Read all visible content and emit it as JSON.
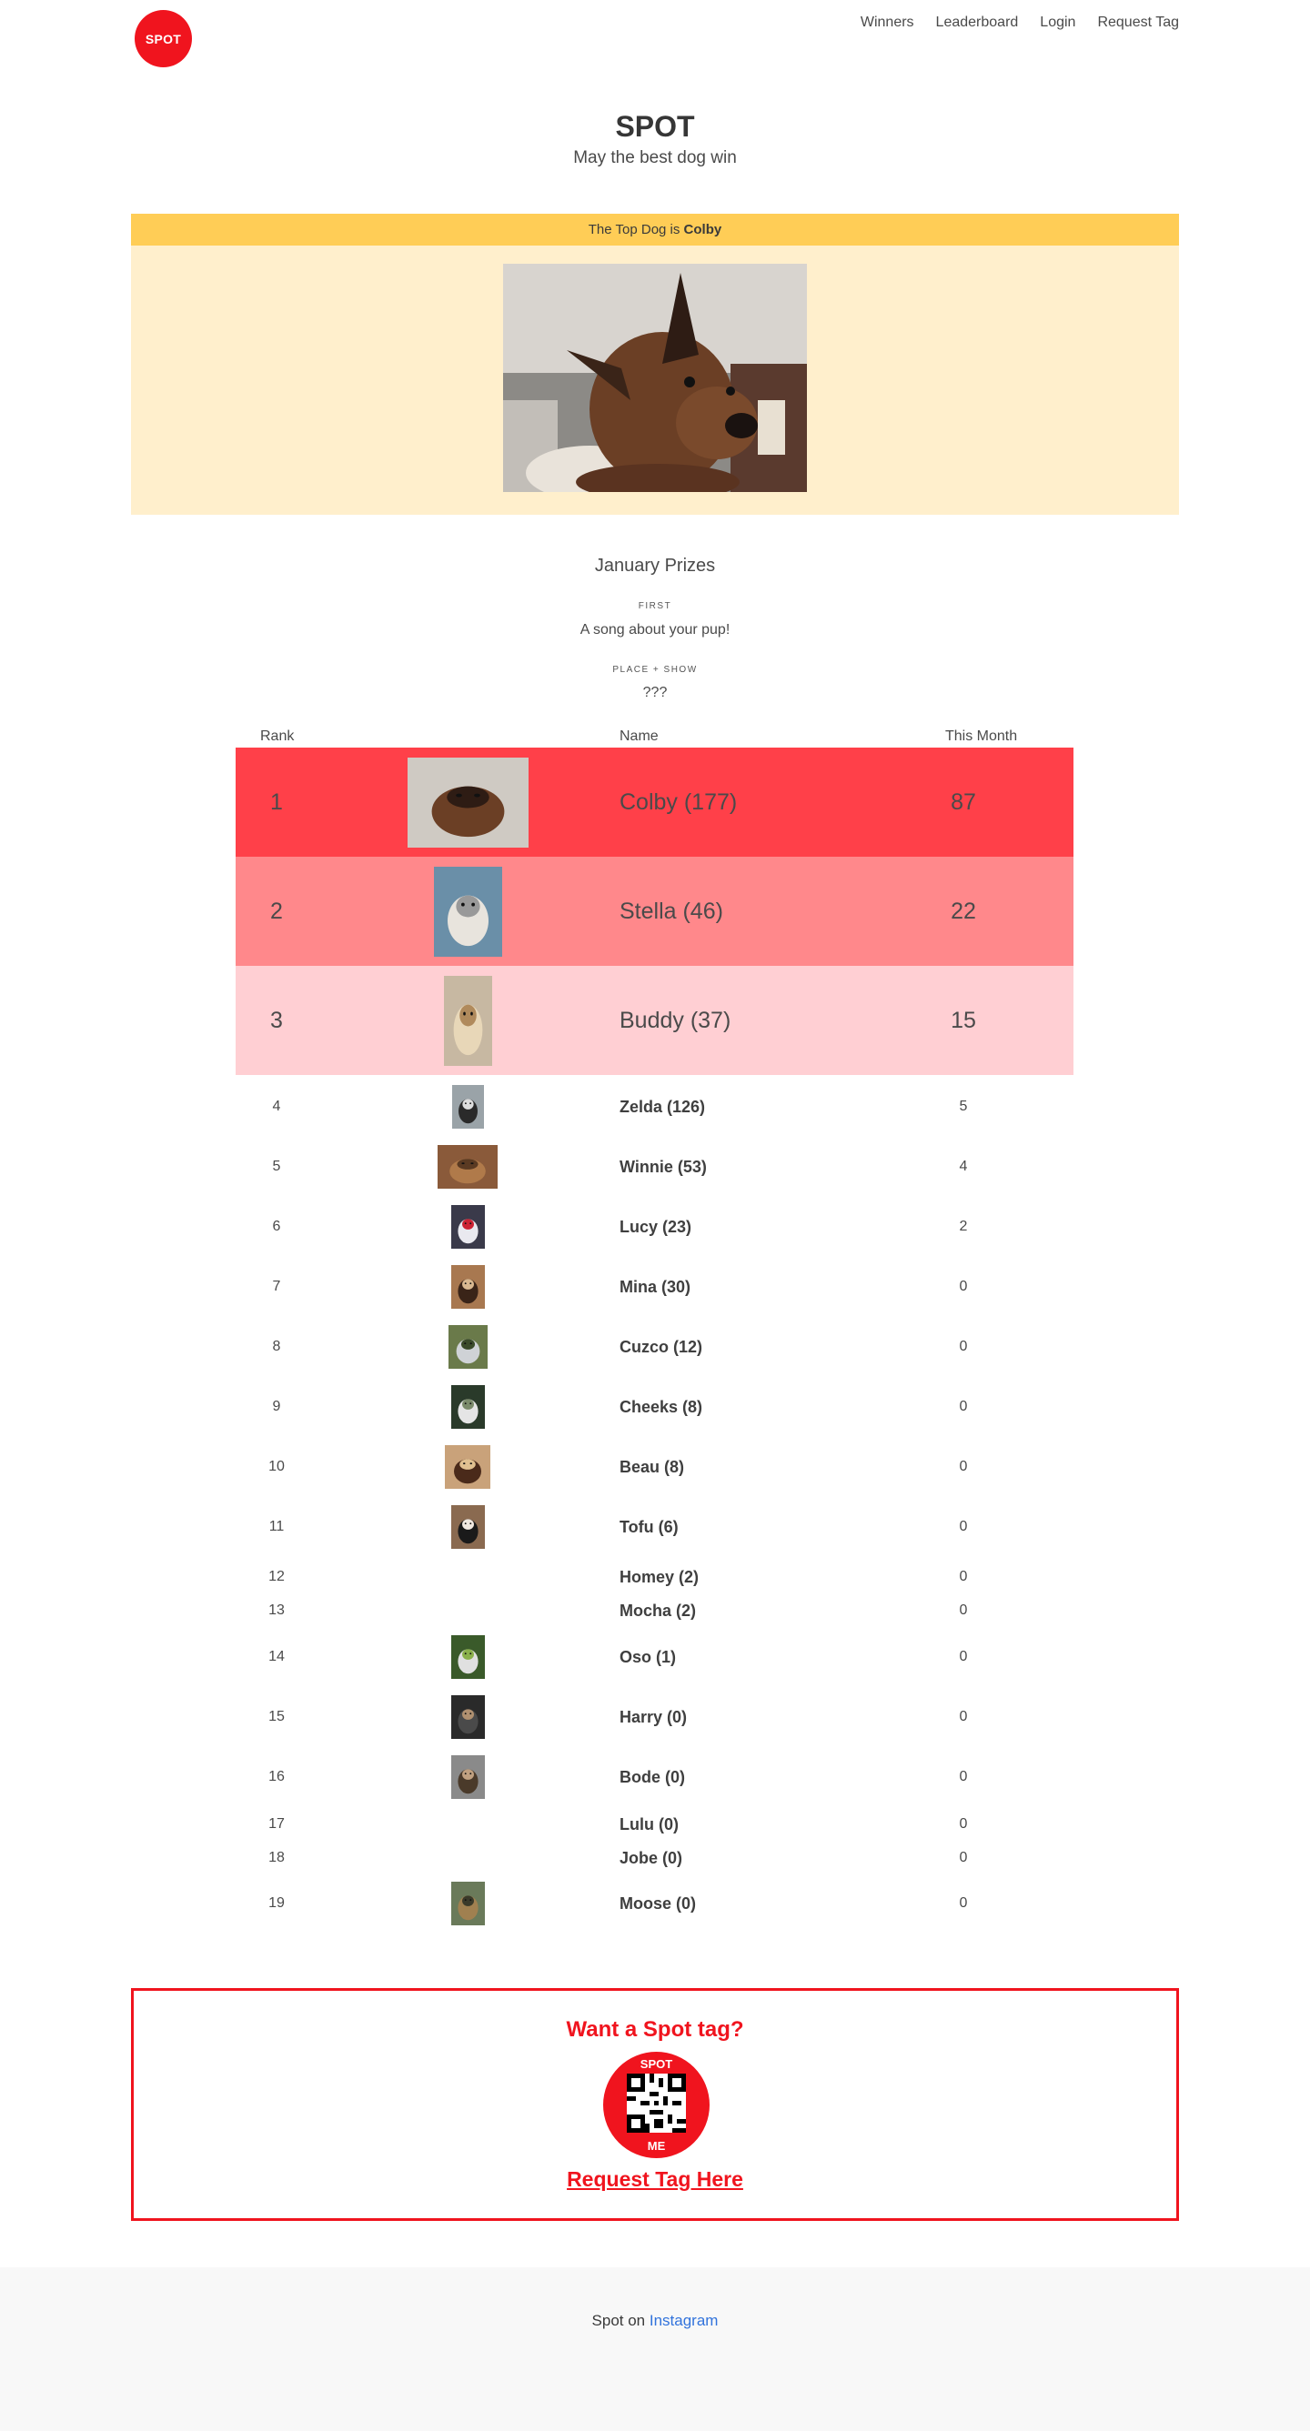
{
  "header": {
    "logo_text": "SPOT",
    "nav": [
      "Winners",
      "Leaderboard",
      "Login",
      "Request Tag"
    ]
  },
  "hero": {
    "title": "SPOT",
    "subtitle": "May the best dog win"
  },
  "top_dog": {
    "prefix": "The Top Dog is ",
    "name": "Colby"
  },
  "prizes": {
    "title": "January Prizes",
    "first_label": "FIRST",
    "first_value": "A song about your pup!",
    "place_label": "PLACE + SHOW",
    "place_value": "???"
  },
  "leaderboard": {
    "headers": {
      "rank": "Rank",
      "name": "Name",
      "month": "This Month"
    },
    "rows": [
      {
        "rank": "1",
        "name": "Colby (177)",
        "month": "87",
        "photo": true
      },
      {
        "rank": "2",
        "name": "Stella (46)",
        "month": "22",
        "photo": true
      },
      {
        "rank": "3",
        "name": "Buddy (37)",
        "month": "15",
        "photo": true
      },
      {
        "rank": "4",
        "name": "Zelda (126)",
        "month": "5",
        "photo": true
      },
      {
        "rank": "5",
        "name": "Winnie (53)",
        "month": "4",
        "photo": true
      },
      {
        "rank": "6",
        "name": "Lucy (23)",
        "month": "2",
        "photo": true
      },
      {
        "rank": "7",
        "name": "Mina (30)",
        "month": "0",
        "photo": true
      },
      {
        "rank": "8",
        "name": "Cuzco (12)",
        "month": "0",
        "photo": true
      },
      {
        "rank": "9",
        "name": "Cheeks (8)",
        "month": "0",
        "photo": true
      },
      {
        "rank": "10",
        "name": "Beau (8)",
        "month": "0",
        "photo": true
      },
      {
        "rank": "11",
        "name": "Tofu (6)",
        "month": "0",
        "photo": true
      },
      {
        "rank": "12",
        "name": "Homey (2)",
        "month": "0",
        "photo": false
      },
      {
        "rank": "13",
        "name": "Mocha (2)",
        "month": "0",
        "photo": false
      },
      {
        "rank": "14",
        "name": "Oso (1)",
        "month": "0",
        "photo": true
      },
      {
        "rank": "15",
        "name": "Harry (0)",
        "month": "0",
        "photo": true
      },
      {
        "rank": "16",
        "name": "Bode (0)",
        "month": "0",
        "photo": true
      },
      {
        "rank": "17",
        "name": "Lulu (0)",
        "month": "0",
        "photo": false
      },
      {
        "rank": "18",
        "name": "Jobe (0)",
        "month": "0",
        "photo": false
      },
      {
        "rank": "19",
        "name": "Moose (0)",
        "month": "0",
        "photo": true
      }
    ]
  },
  "cta": {
    "title": "Want a Spot tag?",
    "badge_top": "SPOT",
    "badge_bottom": "ME",
    "link": "Request Tag Here"
  },
  "footer": {
    "prefix": "Spot on ",
    "link": "Instagram"
  },
  "colors": {
    "brand_red": "#f0141e",
    "rank1": "#ff4049",
    "rank2": "#ff888b",
    "rank3": "#ffcfd3",
    "topdog_bar": "#ffcd56",
    "topdog_panel": "#ffefcc",
    "link_blue": "#3273dc"
  }
}
